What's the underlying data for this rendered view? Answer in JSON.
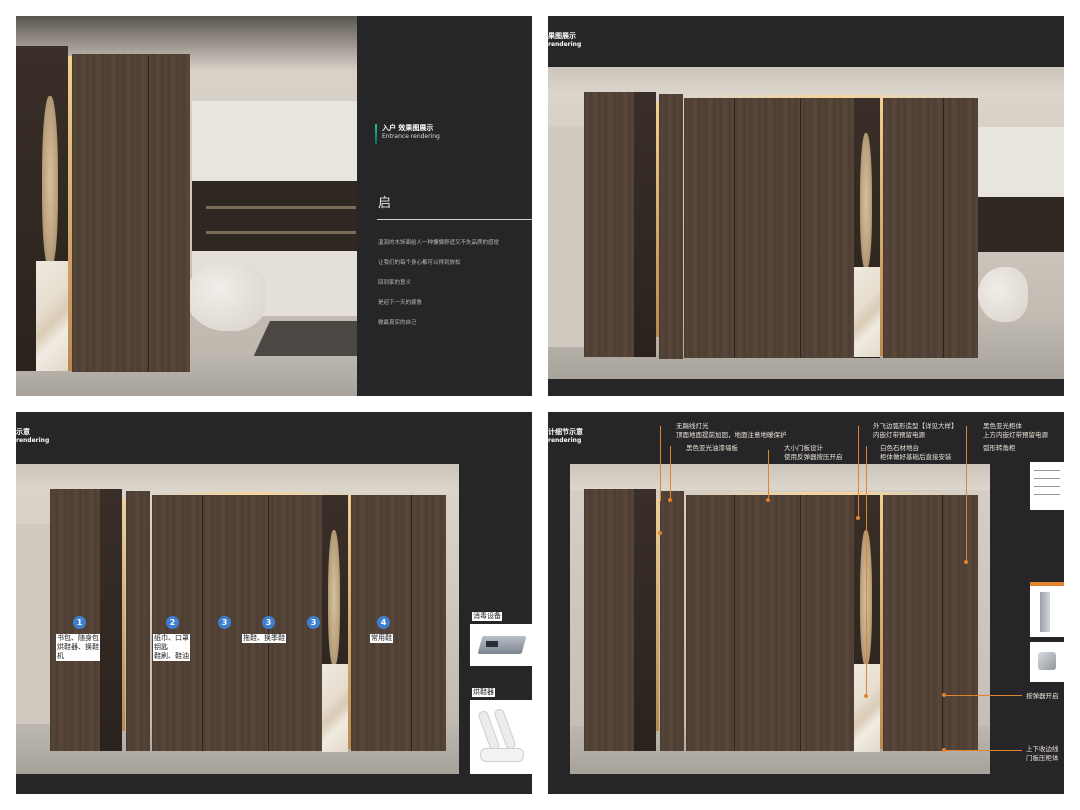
{
  "slide1": {
    "heading": "入户  效果图展示",
    "heading_en": "Entrance  rendering",
    "big_char": "启",
    "poem": [
      "温润的木饰面给人一种慵懒舒适又不失品质的感觉",
      "让我们的每个身心都可以得到放松",
      "回到家的意义",
      "是迎下一天的疲惫",
      "做最真实的自己"
    ],
    "accent_color": "#1aa37a"
  },
  "slide2": {
    "title": "果图展示",
    "title_en": "rendering"
  },
  "slide3": {
    "title": "示意",
    "title_en": "rendering",
    "numbers": [
      "1",
      "2",
      "3",
      "3",
      "3",
      "4"
    ],
    "zone_labels": [
      "书包、随身包\n烘鞋器、换鞋\n机",
      "纸巾、口罩\n钥匙\n鞋刷、鞋油",
      "拖鞋、换季鞋",
      "常用鞋"
    ],
    "side_items": [
      "消毒设备",
      "烘鞋器"
    ],
    "number_color": "#3f7fd0"
  },
  "slide4": {
    "title": "计细节示意",
    "title_en": "rendering",
    "annotations": [
      "无踢线灯光\n顶面地面提前加固，地面注意地暖保护",
      "黑色亚光油漆墙板",
      "大小门板设计\n使用反弹器按压开启",
      "外飞边弧形造型【详见大样】\n内嵌灯带预留电源",
      "白色石材地台\n柜体做好基础后直接安装",
      "黑色亚光柜体\n上方内嵌灯带预留电源",
      "弧形转角柜",
      "按弹器开启",
      "上下收边线\n门板压柜体"
    ],
    "leader_color": "#e1842f"
  }
}
